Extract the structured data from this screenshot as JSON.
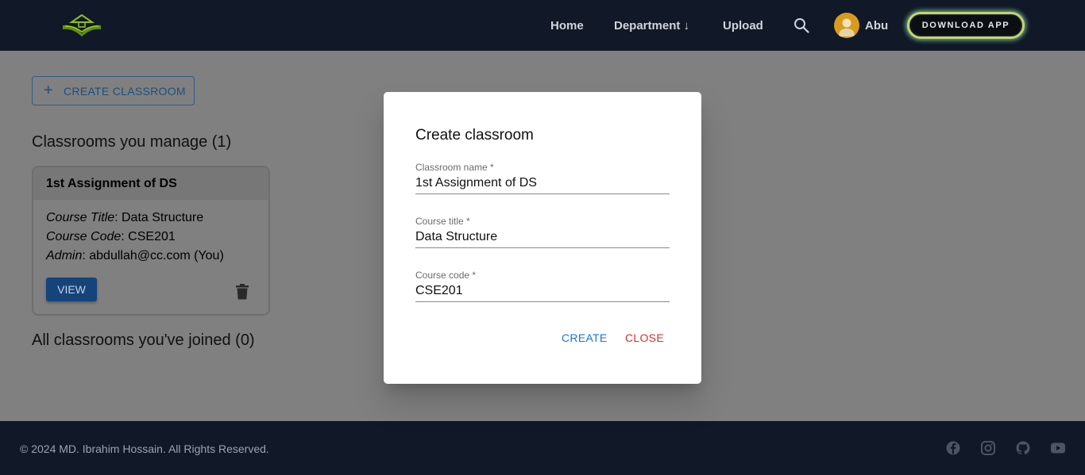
{
  "header": {
    "nav": {
      "home": "Home",
      "department": "Department ↓",
      "upload": "Upload"
    },
    "user_name": "Abu",
    "download_label": "DOWNLOAD APP"
  },
  "main": {
    "create_classroom_label": "CREATE CLASSROOM",
    "managed_title": "Classrooms you manage (1)",
    "card": {
      "title": "1st Assignment of DS",
      "course_title_key": "Course Title",
      "course_title_value": ": Data Structure",
      "course_code_key": "Course Code",
      "course_code_value": ": CSE201",
      "admin_key": "Admin",
      "admin_value": ": abdullah@cc.com (You)",
      "view_label": "VIEW"
    },
    "joined_title": "All classrooms you've joined (0)"
  },
  "dialog": {
    "title": "Create classroom",
    "fields": [
      {
        "label": "Classroom name *",
        "value": "1st Assignment of DS"
      },
      {
        "label": "Course title *",
        "value": "Data Structure"
      },
      {
        "label": "Course code *",
        "value": "CSE201"
      }
    ],
    "create_label": "CREATE",
    "close_label": "CLOSE"
  },
  "footer": {
    "copyright": "© 2024 MD. Ibrahim Hossain. All Rights Reserved.",
    "social_icons": [
      "facebook-icon",
      "instagram-icon",
      "github-icon",
      "youtube-icon"
    ]
  },
  "colors": {
    "header_bg": "#111827",
    "overlay_bg": "#808080",
    "primary": "#1976d2",
    "danger": "#d32f2f"
  }
}
